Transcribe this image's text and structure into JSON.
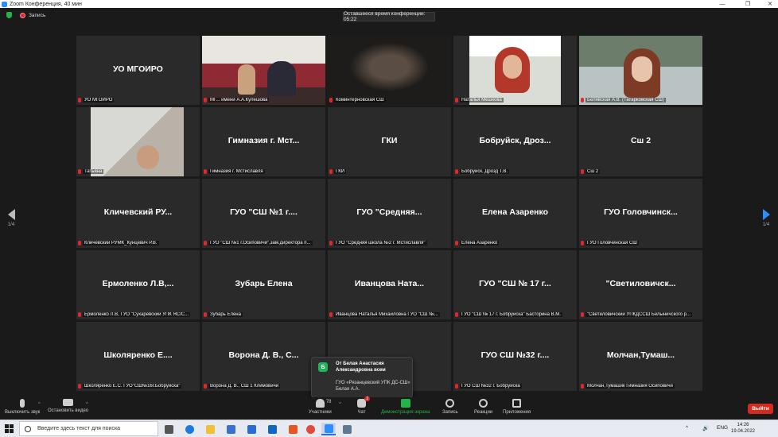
{
  "window": {
    "title": "Zoom Конференция, 40 мин"
  },
  "header": {
    "recording_label": "Запись",
    "timer_text": "Оставшееся время конференции: 05:22"
  },
  "colors": {
    "accent": "#2d8cff",
    "leave": "#d52b1e",
    "active_speaker": "#c8e227",
    "share": "#24b24b"
  },
  "pager": {
    "left_label": "1/4",
    "right_label": "1/4"
  },
  "tiles": [
    {
      "big": "УО МГОИРО",
      "cap": "УО МГОИРО",
      "video": "none"
    },
    {
      "big": "",
      "cap": "МГ... имени А.А.Кулешова",
      "video": "room",
      "active": true
    },
    {
      "big": "",
      "cap": "Коминтерновская СШ",
      "video": "dark"
    },
    {
      "big": "",
      "cap": "Наталья Мешкова",
      "video": "red"
    },
    {
      "big": "",
      "cap": "Белявская А.В. (Татарковская СШ)",
      "video": "green"
    },
    {
      "big": "",
      "cap": "Татьяна",
      "video": "light"
    },
    {
      "big": "Гимназия г. Мст...",
      "cap": "Гимназия г. Мстиславля",
      "video": "none"
    },
    {
      "big": "ГКИ",
      "cap": "ГКИ",
      "video": "none"
    },
    {
      "big": "Бобруйск, Дроз...",
      "cap": "Бобруйск, Дрозд Т.В.",
      "video": "none"
    },
    {
      "big": "Сш 2",
      "cap": "Сш 2",
      "video": "none"
    },
    {
      "big": "Кличевский РУ...",
      "cap": "Кличевский РУМК_Кунцевич Р.В.",
      "video": "none"
    },
    {
      "big": "ГУО \"СШ №1 г....",
      "cap": "ГУО \"СШ №1 г.Осиповичи\",зам.директора п...",
      "video": "none"
    },
    {
      "big": "ГУО \"Средняя...",
      "cap": "ГУО \"Средняя школа №2 г. Мстиславля\"",
      "video": "none"
    },
    {
      "big": "Елена Азаренко",
      "cap": "Елена Азаренко",
      "video": "none"
    },
    {
      "big": "ГУО Головчинск...",
      "cap": "ГУО Головчинская СШ",
      "video": "none"
    },
    {
      "big": "Ермоленко Л.В,...",
      "cap": "Ермоленко Л.В, ГУО \"Сухаревский УПК ЯС/С...",
      "video": "none"
    },
    {
      "big": "Зубарь Елена",
      "cap": "Зубарь Елена",
      "video": "none"
    },
    {
      "big": "Иванцова Ната...",
      "cap": "Иванцова Наталья Михайловна ГУО \"СШ №...",
      "video": "none"
    },
    {
      "big": "ГУО \"СШ № 17 г...",
      "cap": "ГУО \"СШ № 17 г. Бобруйска\" Басторина В.М.",
      "video": "none"
    },
    {
      "big": "\"Светиловичск...",
      "cap": "\"Светиловичский УПКДССШ Белыничского р...",
      "video": "none"
    },
    {
      "big": "Школяренко Е....",
      "cap": "Школяренко Е.С. ГУО\"СШ№16г.Бобруйска\"",
      "video": "none"
    },
    {
      "big": "Ворона Д. В., С...",
      "cap": "Ворона Д. В., СШ 1 Климовичи",
      "video": "none"
    },
    {
      "big": "",
      "cap": "...й УПКдетс...",
      "video": "none"
    },
    {
      "big": "ГУО СШ №32 г....",
      "cap": "ГУО СШ №32 г. Бобруйска",
      "video": "none"
    },
    {
      "big": "Молчан,Тумаш...",
      "cap": "Молчан,Тумашик Гимназия Осиповичи",
      "video": "none"
    }
  ],
  "chat_popup": {
    "avatar": "Б",
    "from": "От Белая Анастасия Александровна всем",
    "message": "ГУО «Рязанцевский УПК ДС-СШ» Белая А.А."
  },
  "toolbar": {
    "mute": "Выключить звук",
    "video": "Остановить видео",
    "participants": "Участники",
    "participants_count": "78",
    "chat": "Чат",
    "chat_badge": "2",
    "share": "Демонстрация экрана",
    "record": "Запись",
    "reactions": "Реакции",
    "apps": "Приложения",
    "leave": "Выйти"
  },
  "taskbar": {
    "search_placeholder": "Введите здесь текст для поиска",
    "lang": "ENG",
    "time": "14:26",
    "date": "19.04.2022",
    "apps": [
      {
        "name": "task-view-icon",
        "color": "#555555"
      },
      {
        "name": "edge-icon",
        "color": "#1f7ae0"
      },
      {
        "name": "file-explorer-icon",
        "color": "#f2c037"
      },
      {
        "name": "store-icon",
        "color": "#3b6fd1"
      },
      {
        "name": "mail-icon",
        "color": "#2b6cd4"
      },
      {
        "name": "outlook-icon",
        "color": "#1166c2"
      },
      {
        "name": "office-icon",
        "color": "#e8561f"
      },
      {
        "name": "chrome-icon",
        "color": "#e24a3b"
      },
      {
        "name": "zoom-icon",
        "color": "#2d8cff"
      },
      {
        "name": "app-icon",
        "color": "#5e7a91"
      }
    ]
  }
}
